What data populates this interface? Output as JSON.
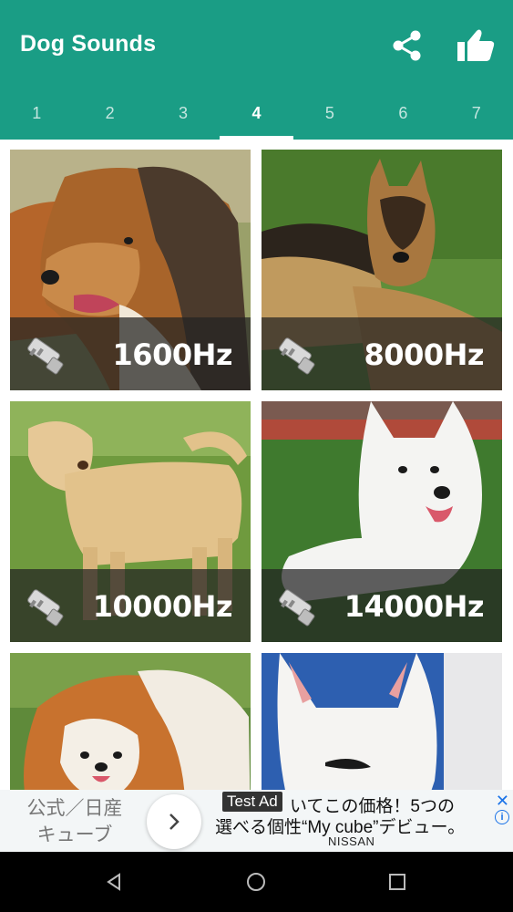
{
  "app": {
    "title": "Dog Sounds"
  },
  "header_icons": {
    "share": "share-icon",
    "like": "thumbs-up-icon"
  },
  "tabs": [
    {
      "label": "1"
    },
    {
      "label": "2"
    },
    {
      "label": "3"
    },
    {
      "label": "4"
    },
    {
      "label": "5"
    },
    {
      "label": "6"
    },
    {
      "label": "7"
    }
  ],
  "active_tab": "4",
  "cards": [
    {
      "freq": "1600Hz",
      "photo": "rough collie"
    },
    {
      "freq": "8000Hz",
      "photo": "german shepherd"
    },
    {
      "freq": "10000Hz",
      "photo": "labrador retriever"
    },
    {
      "freq": "14000Hz",
      "photo": "white spitz"
    },
    {
      "freq": "",
      "photo": "pomeranian"
    },
    {
      "freq": "",
      "photo": "bull terrier"
    }
  ],
  "ad": {
    "left_text_line1": "公式／日産",
    "left_text_line2": "キューブ",
    "badge": "Test Ad",
    "line1": "いてこの価格！5つの",
    "line2": "選べる個性“My cube”デビュー。",
    "brand": "NISSAN",
    "close": "✕",
    "info": "i"
  },
  "colors": {
    "appbar": "#1a9d85",
    "accent": "#ffffff",
    "overlay": "#232323"
  }
}
